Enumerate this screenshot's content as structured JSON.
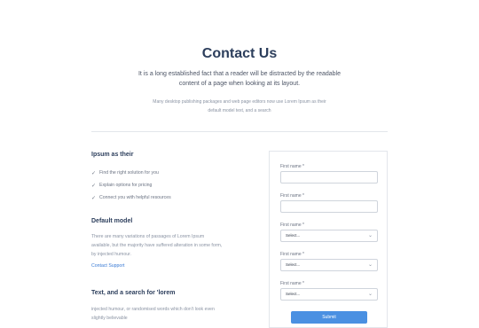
{
  "header": {
    "title": "Contact Us",
    "lead": "It is a long established fact that a reader will be distracted by the readable content of a page when looking at its layout.",
    "sub": "Many desktop publishing packages and web page editors now use Lorem Ipsum as their default model text, and a search"
  },
  "left": {
    "section1": {
      "title": "Ipsum as their",
      "items": [
        "Find the right solution for you",
        "Explain options for pricing",
        "Connect you with helpful resources"
      ]
    },
    "section2": {
      "title": "Default model",
      "text": "There are many variations of passages of Lorem Ipsum available, but the majority have suffered alteration in some form, by injected humour.",
      "link": "Contact Support"
    },
    "section3": {
      "title": "Text, and a search for 'lorem",
      "text": "injected humour, or randomised words which don't look even slightly believable"
    }
  },
  "form": {
    "fields": [
      {
        "label": "First name *",
        "kind": "input"
      },
      {
        "label": "First name *",
        "kind": "input"
      },
      {
        "label": "First name *",
        "kind": "select",
        "value": "Select..."
      },
      {
        "label": "First name *",
        "kind": "select",
        "value": "Select..."
      },
      {
        "label": "First name *",
        "kind": "select",
        "value": "Select..."
      }
    ],
    "submit": "Submit"
  },
  "colors": {
    "accent": "#4a90e2",
    "heading": "#2c3e5c",
    "link": "#3a7bd5"
  }
}
